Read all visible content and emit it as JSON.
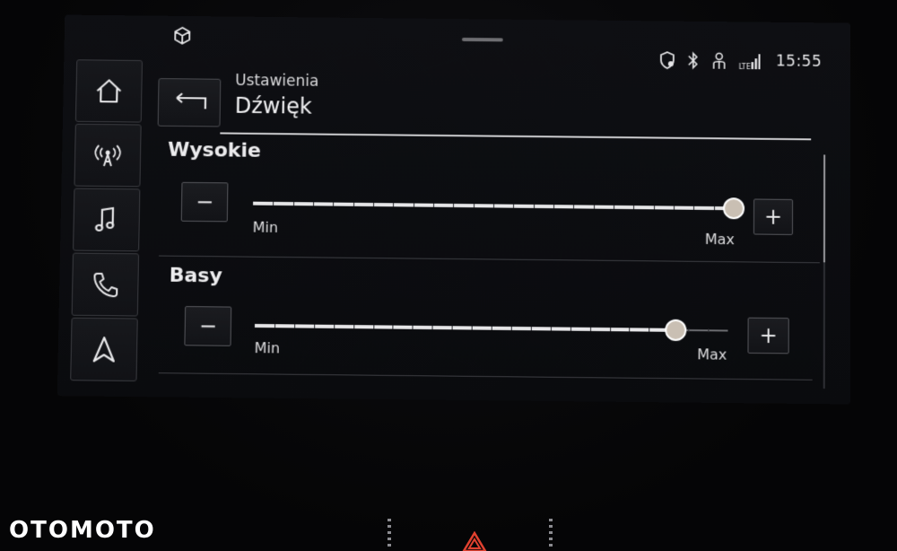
{
  "status": {
    "time": "15:55"
  },
  "nav": {
    "items": [
      {
        "name": "home",
        "icon": "home-icon"
      },
      {
        "name": "radio",
        "icon": "radio-antenna-icon"
      },
      {
        "name": "media",
        "icon": "music-note-icon"
      },
      {
        "name": "phone",
        "icon": "phone-icon"
      },
      {
        "name": "navigation",
        "icon": "navigation-arrow-icon"
      }
    ]
  },
  "header": {
    "breadcrumb": "Ustawienia",
    "title": "Dźwięk"
  },
  "sections": [
    {
      "title": "Wysokie",
      "min_label": "Min",
      "max_label": "Max",
      "minus_label": "−",
      "plus_label": "+",
      "value_fraction": 1.0
    },
    {
      "title": "Basy",
      "min_label": "Min",
      "max_label": "Max",
      "minus_label": "−",
      "plus_label": "+",
      "value_fraction": 0.89
    }
  ],
  "watermark": "OTOMOTO",
  "colors": {
    "accent": "#e6e6e8",
    "thumb": "#c9bfb3",
    "hazard": "#e0412f"
  }
}
